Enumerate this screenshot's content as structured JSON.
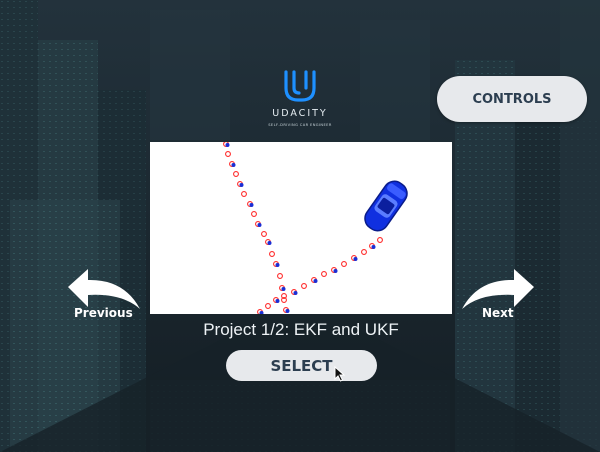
{
  "brand": {
    "name": "UDACITY",
    "tagline": "SELF-DRIVING CAR ENGINEER"
  },
  "header": {
    "controls_label": "CONTROLS"
  },
  "project": {
    "title": "Project 1/2: EKF and UKF",
    "select_label": "SELECT"
  },
  "navigation": {
    "previous_label": "Previous",
    "next_label": "Next"
  },
  "icons": {
    "logo": "udacity-u-logo",
    "previous": "curved-left-arrow-icon",
    "next": "curved-right-arrow-icon",
    "cursor": "mouse-pointer-icon"
  },
  "colors": {
    "accent_blue": "#1e90ff",
    "button_bg": "#e7e9ec",
    "button_text": "#2c3e50",
    "marker_red": "#ff2a2a",
    "marker_blue": "#1a2fd6",
    "car_blue": "#1030e0"
  }
}
